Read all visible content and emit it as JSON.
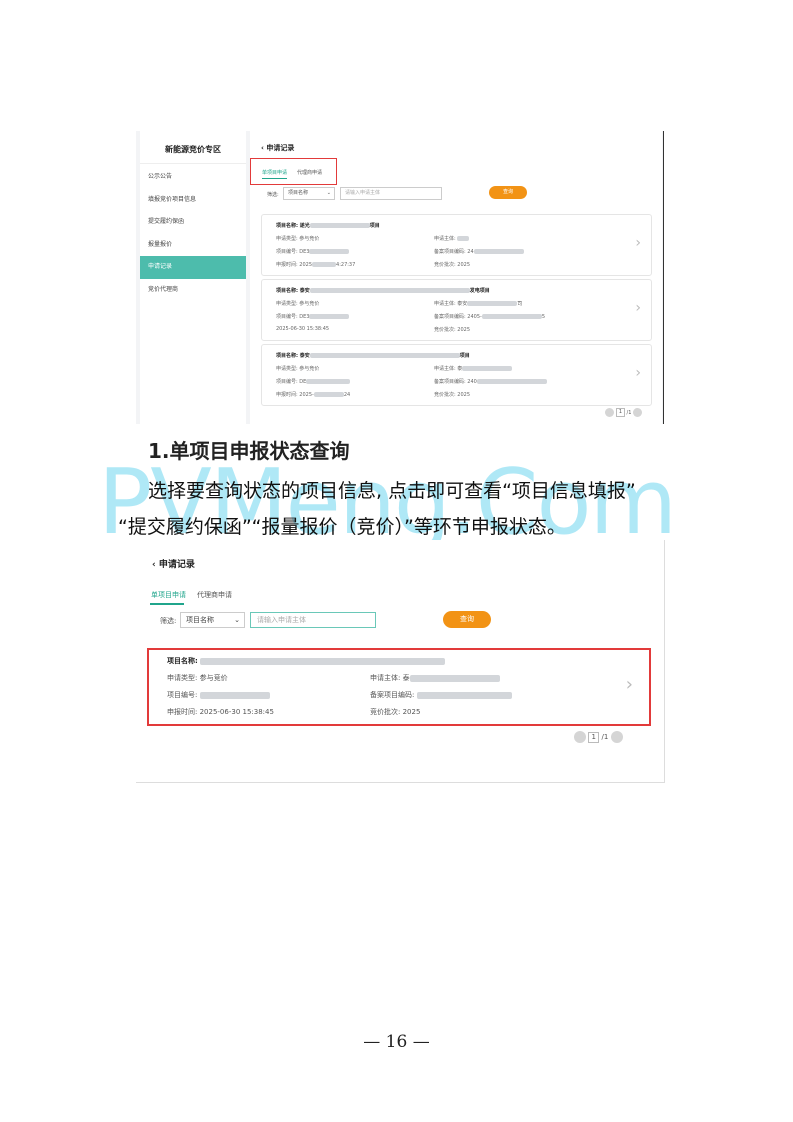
{
  "shot1": {
    "sidebar": {
      "brand": "新能源竞价专区",
      "items": [
        "公示公告",
        "填报竞价项目信息",
        "提交履约保函",
        "报量报价",
        "申请记录",
        "竞价代理商"
      ],
      "active_index": 4
    },
    "header": {
      "back_icon": "‹",
      "title": "申请记录"
    },
    "tabs": [
      "单项目申请",
      "代理商申请"
    ],
    "filter": {
      "label": "筛选:",
      "select_value": "项目名称",
      "input_placeholder": "请输入申请主体",
      "search_button": "查询"
    },
    "cards": [
      {
        "name_label": "项目名称:",
        "name_prefix": "遂光",
        "name_suffix": "项目",
        "type_label": "申请类型:",
        "type_value": "参与竞价",
        "subject_label": "申请主体:",
        "subject_prefix": "",
        "code_label": "项目编号:",
        "code_prefix": "DE3",
        "record_label": "备案项目编码:",
        "record_prefix": "24",
        "time_label": "申报时间:",
        "time_prefix": "2025",
        "time_suffix": "4:27:37",
        "batch_label": "竞价批次:",
        "batch_value": "2025"
      },
      {
        "name_label": "项目名称:",
        "name_prefix": "泰安",
        "name_suffix": "发电项目",
        "type_label": "申请类型:",
        "type_value": "参与竞价",
        "subject_label": "申请主体:",
        "subject_prefix": "泰安",
        "subject_suffix": "司",
        "code_label": "项目编号:",
        "code_prefix": "DE3",
        "record_label": "备案项目编码:",
        "record_prefix": "2405-",
        "record_suffix": "5",
        "time_label": "申报时间:",
        "time_value": "2025-06-30 15:38:45",
        "batch_label": "竞价批次:",
        "batch_value": "2025"
      },
      {
        "name_label": "项目名称:",
        "name_prefix": "泰安",
        "name_suffix": "项目",
        "type_label": "申请类型:",
        "type_value": "参与竞价",
        "subject_label": "申请主体:",
        "subject_prefix": "泰",
        "code_label": "项目编号:",
        "code_prefix": "DE",
        "record_label": "备案项目编码:",
        "record_prefix": "240",
        "time_label": "申报时间:",
        "time_prefix": "2025-",
        "time_suffix": "24",
        "batch_label": "竞价批次:",
        "batch_value": "2025"
      }
    ],
    "pager": {
      "current": "1",
      "total": "/1"
    }
  },
  "section": {
    "title": "1.单项目申报状态查询",
    "line1": "选择要查询状态的项目信息, 点击即可查看“项目信息填报”",
    "line2": "“提交履约保函”“报量报价（竞价）”等环节申报状态。"
  },
  "watermark": "PVMeng.Com",
  "shot2": {
    "header": {
      "back_icon": "‹",
      "title": "申请记录"
    },
    "tabs": [
      "单项目申请",
      "代理商申请"
    ],
    "filter": {
      "label": "筛选:",
      "select_value": "项目名称",
      "input_placeholder": "请输入申请主体",
      "search_button": "查询"
    },
    "card": {
      "name_label": "项目名称:",
      "type_label": "申请类型:",
      "type_value": "参与竞价",
      "subject_label": "申请主体:",
      "subject_prefix": "泰",
      "code_label": "项目编号:",
      "record_label": "备案项目编码:",
      "time_label": "申报时间:",
      "time_value": "2025-06-30 15:38:45",
      "batch_label": "竞价批次:",
      "batch_value": "2025"
    },
    "pager": {
      "current": "1",
      "total": "/1"
    }
  },
  "page_number": "— 16 —",
  "colors": {
    "accent_teal": "#4dbcac",
    "button_orange": "#f29315",
    "highlight_red": "#e23a3a",
    "watermark": "#6fd6f0"
  }
}
